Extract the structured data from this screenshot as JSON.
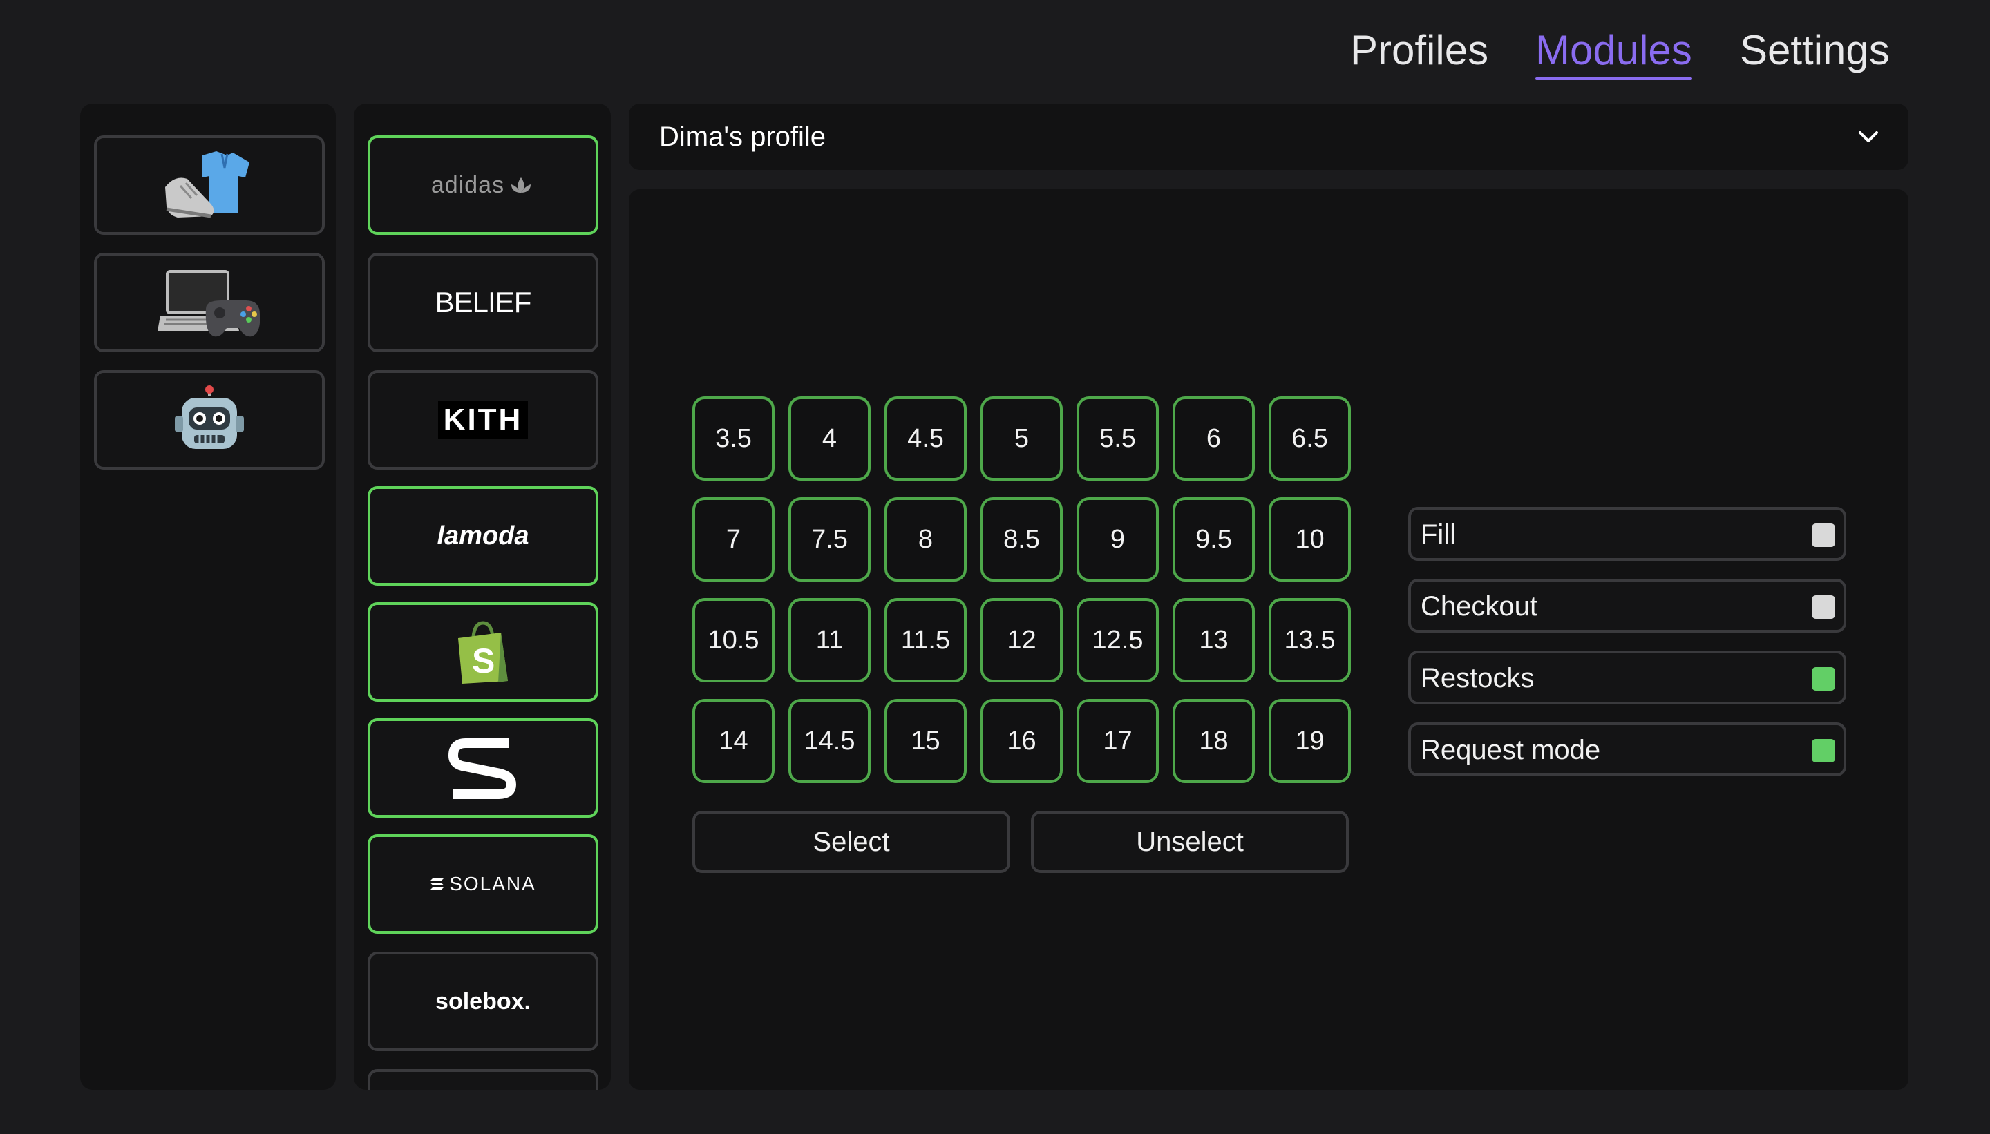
{
  "nav": {
    "profiles": "Profiles",
    "modules": "Modules",
    "settings": "Settings",
    "active": "Modules",
    "accent": "#8a6cf0"
  },
  "categories": [
    {
      "icon": "sneaker-shirt-icon"
    },
    {
      "icon": "laptop-gamepad-icon"
    },
    {
      "icon": "robot-icon"
    }
  ],
  "stores": [
    {
      "label": "adidas",
      "icon": "adidas-logo-icon",
      "selected": true
    },
    {
      "label": "BELIEF",
      "icon": "belief-logo-icon",
      "selected": false
    },
    {
      "label": "KITH",
      "icon": "kith-logo-icon",
      "selected": false
    },
    {
      "label": "lamoda",
      "icon": "lamoda-logo-icon",
      "selected": true
    },
    {
      "label": "",
      "icon": "shopify-bag-icon",
      "selected": true
    },
    {
      "label": "",
      "icon": "s-logo-icon",
      "selected": true
    },
    {
      "label": "SOLANA",
      "icon": "solana-logo-icon",
      "selected": true
    },
    {
      "label": "solebox.",
      "icon": "solebox-logo-icon",
      "selected": false
    }
  ],
  "profile_select": {
    "value": "Dima's profile"
  },
  "sizes": [
    "3.5",
    "4",
    "4.5",
    "5",
    "5.5",
    "6",
    "6.5",
    "7",
    "7.5",
    "8",
    "8.5",
    "9",
    "9.5",
    "10",
    "10.5",
    "11",
    "11.5",
    "12",
    "12.5",
    "13",
    "13.5",
    "14",
    "14.5",
    "15",
    "16",
    "17",
    "18",
    "19"
  ],
  "actions": {
    "select": "Select",
    "unselect": "Unselect"
  },
  "options": [
    {
      "label": "Fill",
      "checked": false
    },
    {
      "label": "Checkout",
      "checked": false
    },
    {
      "label": "Restocks",
      "checked": true
    },
    {
      "label": "Request mode",
      "checked": true
    }
  ],
  "colors": {
    "selected_border": "#5fd35a",
    "checked": "#62cf66",
    "unchecked": "#d9d9d9"
  }
}
